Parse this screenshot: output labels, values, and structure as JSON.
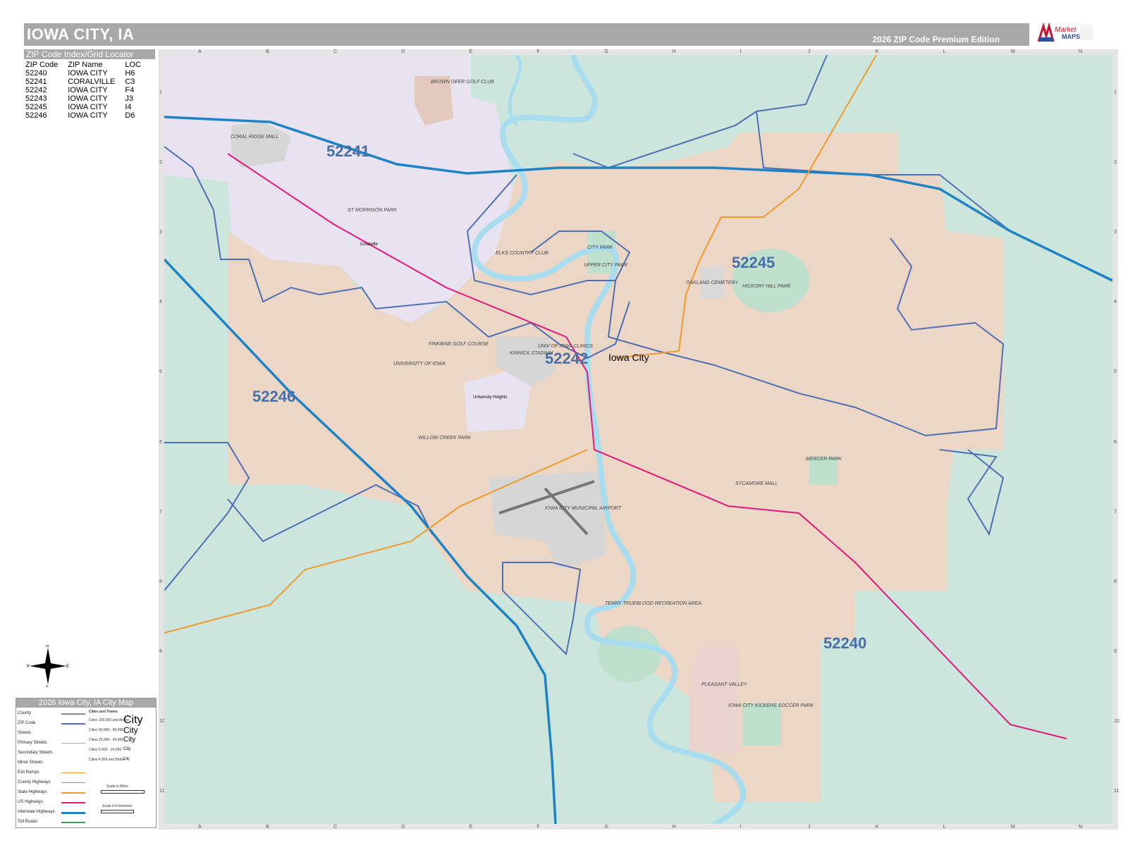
{
  "header": {
    "title": "IOWA CITY, IA",
    "edition": "2026 ZIP Code Premium Edition"
  },
  "logo": {
    "brand_line1": "Market",
    "brand_line2": "MAPS"
  },
  "zip_index": {
    "heading": "ZIP Code Index/Grid Locator",
    "columns": [
      "ZIP Code",
      "ZIP Name",
      "LOC"
    ],
    "rows": [
      [
        "52240",
        "IOWA CITY",
        "H6"
      ],
      [
        "52241",
        "CORALVILLE",
        "C3"
      ],
      [
        "52242",
        "IOWA CITY",
        "F4"
      ],
      [
        "52243",
        "IOWA CITY",
        "J3"
      ],
      [
        "52245",
        "IOWA CITY",
        "I4"
      ],
      [
        "52246",
        "IOWA CITY",
        "D6"
      ]
    ]
  },
  "grid": {
    "columns": [
      "A",
      "B",
      "C",
      "D",
      "E",
      "F",
      "G",
      "H",
      "I",
      "J",
      "K",
      "L",
      "M",
      "N"
    ],
    "rows": [
      "1",
      "2",
      "3",
      "4",
      "5",
      "6",
      "7",
      "8",
      "9",
      "10",
      "11"
    ]
  },
  "map": {
    "zip_labels": [
      "52241",
      "52245",
      "52242",
      "52246",
      "52240"
    ],
    "city_label": "Iowa City",
    "places": {
      "coralville": "Coralville",
      "university_heights": "University Heights",
      "brown_deer": "BROWN DEER GOLF CLUB",
      "coral_ridge": "CORAL RIDGE MALL",
      "st_morrison": "ST MORRISON PARK",
      "elks": "ELKS COUNTRY CLUB",
      "city_park": "CITY PARK",
      "upper_city_park": "UPPER CITY PARK",
      "hickory_hill": "HICKORY HILL PARK",
      "oakland": "OAKLAND CEMETERY",
      "finkbine": "FINKBINE GOLF COURSE",
      "university": "UNIVERSITY OF IOWA",
      "kinnick": "KINNICK STADIUM",
      "clinics": "UNIV OF IOWA CLINICS",
      "willow_creek": "WILLOW CREEK PARK",
      "airport": "IOWA CITY MUNICIPAL AIRPORT",
      "mercer": "MERCER PARK",
      "sycamore": "SYCAMORE MALL",
      "terry": "TERRY TRUEBLOOD RECREATION AREA",
      "pleasant_valley": "PLEASANT VALLEY",
      "kickers": "IOWA CITY KICKERS SOCCER PARK"
    },
    "colors": {
      "county_land": "#cce6dd",
      "iowa_city": "#ecd7c6",
      "coralville": "#e9e2f0",
      "university_heights": "#e8e3f0",
      "parks": "#bfe0cc",
      "water": "#a8dcef",
      "airport": "#d6d6d6",
      "zip_boundary": "#4f6fb4",
      "interstate": "#1e83c6",
      "us_highway": "#e0197d",
      "state_highway": "#f09a2b",
      "zip_label": "#4a6ea8"
    }
  },
  "compass": {
    "n": "N",
    "s": "S",
    "e": "E",
    "w": "W"
  },
  "legend": {
    "title": "2026 Iowa City, IA City Map",
    "items": [
      "County",
      "ZIP Code",
      "Streets",
      "Primary Streets",
      "Secondary Streets",
      "Minor Streets",
      "Exit Ramps",
      "County Highways",
      "State Highways",
      "US Highways",
      "Interstate Highways",
      "Toll Roads"
    ],
    "cities_heading": "Cities and Towns",
    "city_classes": [
      "Cities 100,000 and Above",
      "Cities 50,000 - 99,999",
      "Cities 25,000 - 49,999",
      "Cities 5,000 - 24,999",
      "Cities 4,999 and Below"
    ],
    "city_samples": [
      "City",
      "City",
      "City",
      "City",
      "City"
    ],
    "scale_miles": "Scale in Miles",
    "scale_km": "Scale in Kilometers"
  }
}
